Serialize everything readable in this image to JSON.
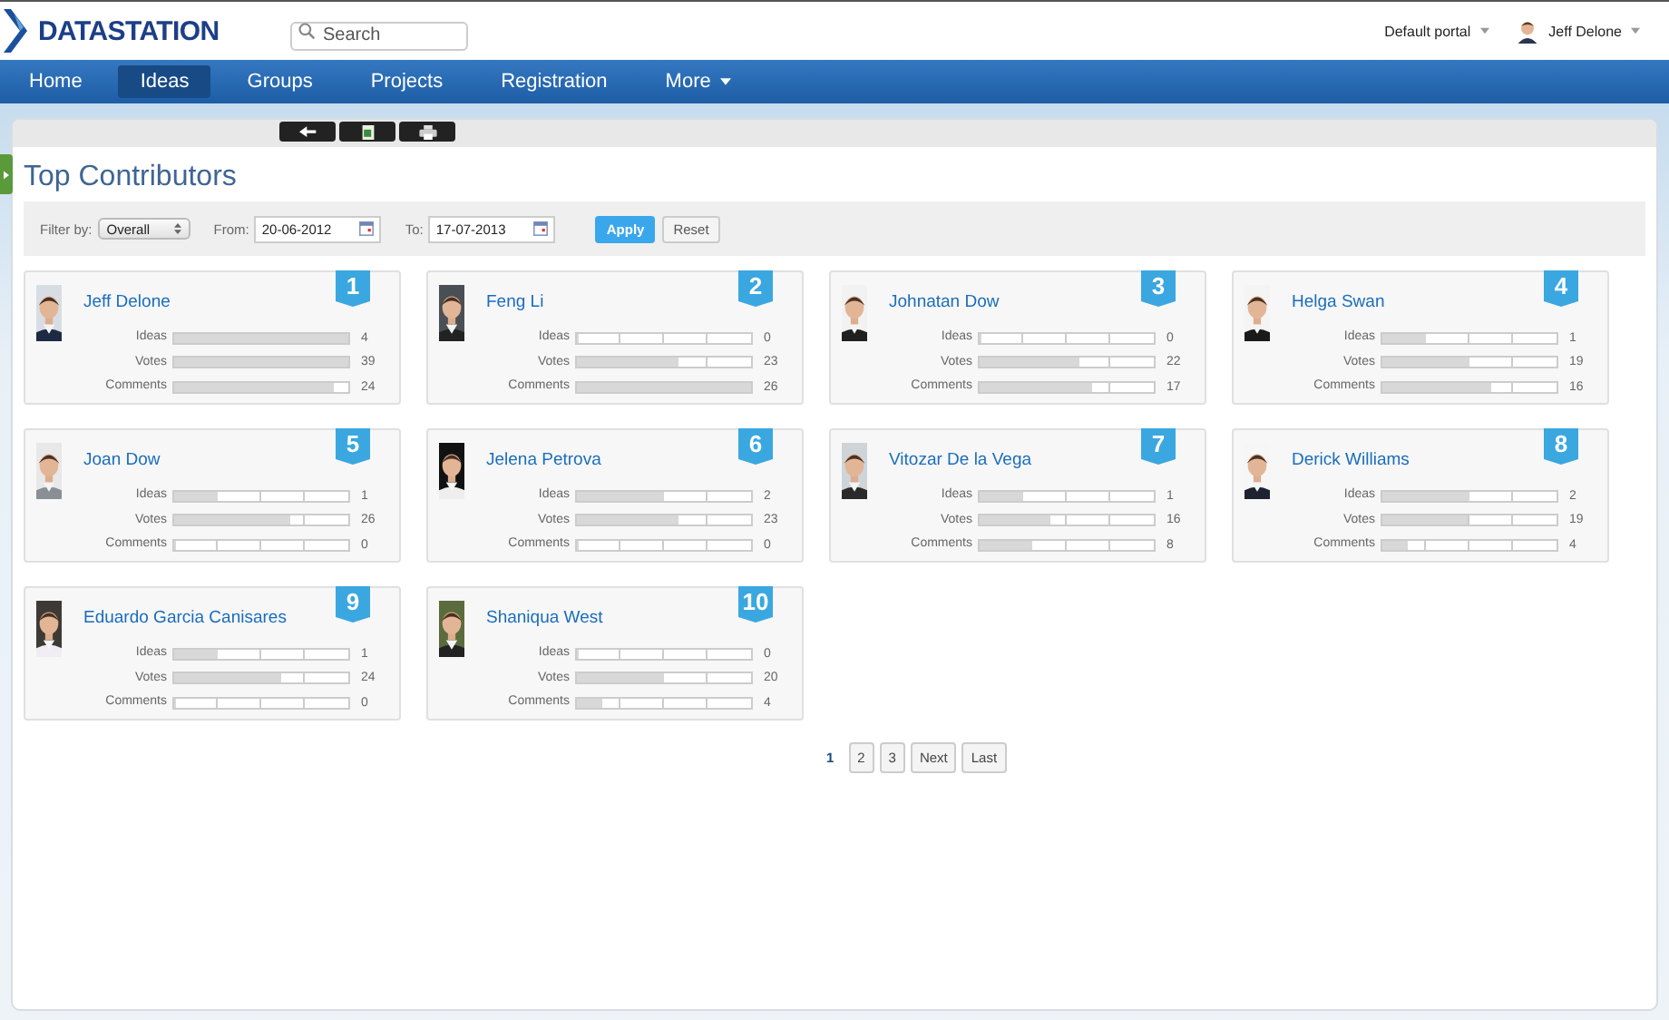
{
  "header": {
    "logo": "DATASTATION",
    "search": {
      "placeholder": "Search"
    },
    "portal": "Default portal",
    "user": {
      "name": "Jeff Delone"
    }
  },
  "nav": [
    {
      "label": "Home",
      "selected": false,
      "dropdown": false
    },
    {
      "label": "Ideas",
      "selected": true,
      "dropdown": false
    },
    {
      "label": "Groups",
      "selected": false,
      "dropdown": false
    },
    {
      "label": "Projects",
      "selected": false,
      "dropdown": false
    },
    {
      "label": "Registration",
      "selected": false,
      "dropdown": false
    },
    {
      "label": "More",
      "selected": false,
      "dropdown": true
    }
  ],
  "title": "Top Contributors",
  "filter": {
    "filter_label": "Filter by:",
    "filter_value": "Overall",
    "from_label": "From:",
    "from_value": "20-06-2012",
    "to_label": "To:",
    "to_value": "17-07-2013",
    "apply": "Apply",
    "reset": "Reset"
  },
  "contributors": [
    {
      "rank": "1",
      "name": "Jeff Delone",
      "stats": [
        {
          "label": "Ideas",
          "level": 1,
          "value": "4"
        },
        {
          "label": "Votes",
          "level": 1,
          "value": "39"
        },
        {
          "label": "Comments",
          "level": 0.92,
          "value": "24"
        }
      ]
    },
    {
      "rank": "2",
      "name": "Feng Li",
      "stats": [
        {
          "label": "Ideas",
          "level": 0,
          "value": "0"
        },
        {
          "label": "Votes",
          "level": 0.58,
          "value": "23"
        },
        {
          "label": "Comments",
          "level": 1,
          "value": "26"
        }
      ]
    },
    {
      "rank": "3",
      "name": "Johnatan Dow",
      "stats": [
        {
          "label": "Ideas",
          "level": 0,
          "value": "0"
        },
        {
          "label": "Votes",
          "level": 0.57,
          "value": "22"
        },
        {
          "label": "Comments",
          "level": 0.65,
          "value": "17"
        }
      ]
    },
    {
      "rank": "4",
      "name": "Helga Swan",
      "stats": [
        {
          "label": "Ideas",
          "level": 0.25,
          "value": "1"
        },
        {
          "label": "Votes",
          "level": 0.5,
          "value": "19"
        },
        {
          "label": "Comments",
          "level": 0.62,
          "value": "16"
        }
      ]
    },
    {
      "rank": "5",
      "name": "Joan Dow",
      "stats": [
        {
          "label": "Ideas",
          "level": 0.25,
          "value": "1"
        },
        {
          "label": "Votes",
          "level": 0.67,
          "value": "26"
        },
        {
          "label": "Comments",
          "level": 0,
          "value": "0"
        }
      ]
    },
    {
      "rank": "6",
      "name": "Jelena Petrova",
      "stats": [
        {
          "label": "Ideas",
          "level": 0.5,
          "value": "2"
        },
        {
          "label": "Votes",
          "level": 0.58,
          "value": "23"
        },
        {
          "label": "Comments",
          "level": 0,
          "value": "0"
        }
      ]
    },
    {
      "rank": "7",
      "name": "Vitozar De la Vega",
      "stats": [
        {
          "label": "Ideas",
          "level": 0.25,
          "value": "1"
        },
        {
          "label": "Votes",
          "level": 0.41,
          "value": "16"
        },
        {
          "label": "Comments",
          "level": 0.3,
          "value": "8"
        }
      ]
    },
    {
      "rank": "8",
      "name": "Derick Williams",
      "stats": [
        {
          "label": "Ideas",
          "level": 0.5,
          "value": "2"
        },
        {
          "label": "Votes",
          "level": 0.49,
          "value": "19"
        },
        {
          "label": "Comments",
          "level": 0.15,
          "value": "4"
        }
      ]
    },
    {
      "rank": "9",
      "name": "Eduardo Garcia Canisares",
      "stats": [
        {
          "label": "Ideas",
          "level": 0.25,
          "value": "1"
        },
        {
          "label": "Votes",
          "level": 0.61,
          "value": "24"
        },
        {
          "label": "Comments",
          "level": 0,
          "value": "0"
        }
      ]
    },
    {
      "rank": "10",
      "name": "Shaniqua West",
      "stats": [
        {
          "label": "Ideas",
          "level": 0,
          "value": "0"
        },
        {
          "label": "Votes",
          "level": 0.5,
          "value": "20"
        },
        {
          "label": "Comments",
          "level": 0.15,
          "value": "4"
        }
      ]
    }
  ],
  "pagination": [
    {
      "label": "1",
      "selected": true
    },
    {
      "label": "2",
      "selected": false
    },
    {
      "label": "3",
      "selected": false
    },
    {
      "label": "Next",
      "selected": false
    },
    {
      "label": "Last",
      "selected": false
    }
  ]
}
